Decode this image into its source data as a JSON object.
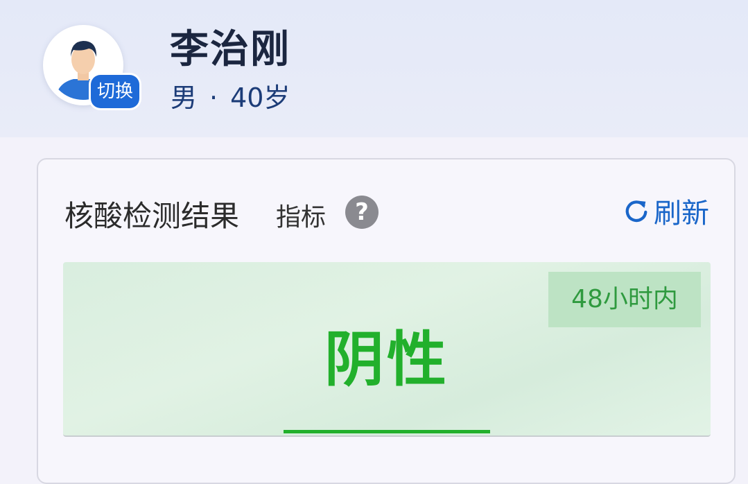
{
  "profile": {
    "name": "李治刚",
    "gender": "男",
    "separator": "·",
    "age": "40岁",
    "switch_label": "切换",
    "avatar_icon": "person-avatar-icon"
  },
  "card": {
    "title": "核酸检测结果",
    "subtitle": "指标",
    "help_symbol": "?",
    "refresh_label": "刷新",
    "refresh_icon": "refresh-icon"
  },
  "result": {
    "status": "阴性",
    "validity": "48小时内"
  },
  "colors": {
    "accent_blue": "#1e6ad8",
    "result_green": "#22b02c",
    "tag_green_bg": "#bde3c4"
  }
}
